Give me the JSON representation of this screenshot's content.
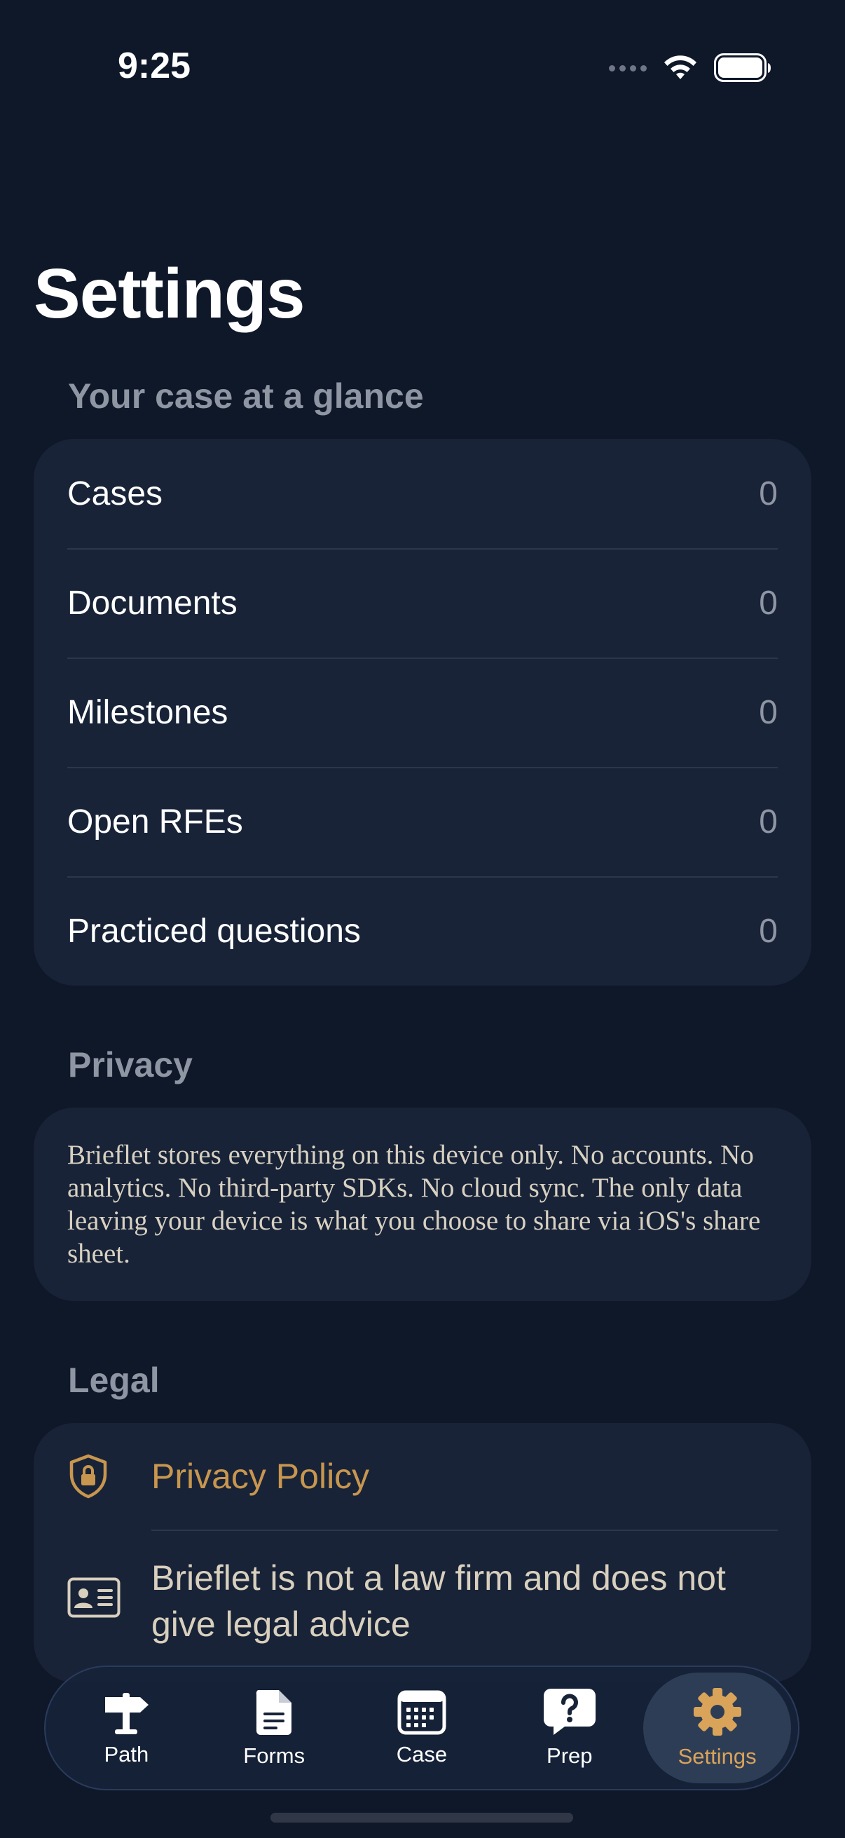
{
  "status_bar": {
    "time": "9:25"
  },
  "page": {
    "title": "Settings"
  },
  "glance": {
    "header": "Your case at a glance",
    "rows": [
      {
        "label": "Cases",
        "value": "0"
      },
      {
        "label": "Documents",
        "value": "0"
      },
      {
        "label": "Milestones",
        "value": "0"
      },
      {
        "label": "Open RFEs",
        "value": "0"
      },
      {
        "label": "Practiced questions",
        "value": "0"
      }
    ]
  },
  "privacy": {
    "header": "Privacy",
    "text": "Brieflet stores everything on this device only. No accounts. No analytics. No third-party SDKs. No cloud sync. The only data leaving your device is what you choose to share via iOS's share sheet."
  },
  "legal": {
    "header": "Legal",
    "privacy_policy": "Privacy Policy",
    "disclaimer": "Brieflet is not a law firm and does not give legal advice"
  },
  "tabs": [
    {
      "label": "Path",
      "icon": "signpost-icon"
    },
    {
      "label": "Forms",
      "icon": "document-icon"
    },
    {
      "label": "Case",
      "icon": "calendar-icon"
    },
    {
      "label": "Prep",
      "icon": "question-bubble-icon"
    },
    {
      "label": "Settings",
      "icon": "gear-icon"
    }
  ],
  "colors": {
    "background": "#0f1829",
    "card": "#182338",
    "accent": "#c8964e",
    "active_tab_label": "#d9a459"
  }
}
